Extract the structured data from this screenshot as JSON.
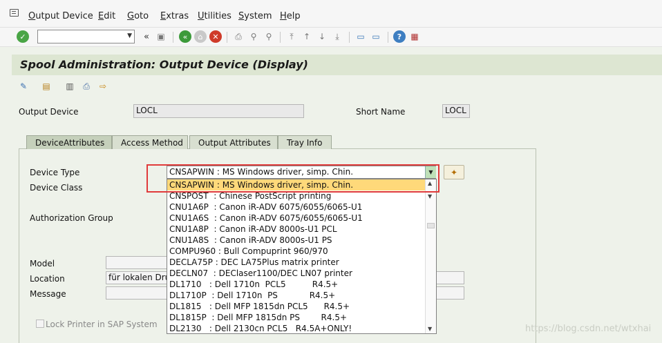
{
  "menu": {
    "items": [
      "Output Device",
      "Edit",
      "Goto",
      "Extras",
      "Utilities",
      "System",
      "Help"
    ]
  },
  "toolbar": {
    "command_value": ""
  },
  "title": "Spool Administration: Output Device (Display)",
  "header": {
    "output_device_label": "Output Device",
    "output_device_value": "LOCL",
    "short_name_label": "Short Name",
    "short_name_value": "LOCL"
  },
  "tabs": [
    {
      "label": "DeviceAttributes",
      "active": true
    },
    {
      "label": "Access Method",
      "active": false
    },
    {
      "label": "Output Attributes",
      "active": false
    },
    {
      "label": "Tray Info",
      "active": false
    }
  ],
  "form": {
    "device_type_label": "Device Type",
    "device_type_value": "CNSAPWIN : MS Windows driver, simp. Chin.",
    "device_class_label": "Device Class",
    "authorization_group_label": "Authorization Group",
    "model_label": "Model",
    "model_value": "",
    "location_label": "Location",
    "location_value": "für lokalen Druck",
    "message_label": "Message",
    "message_value": "",
    "lock_printer_label": "Lock Printer in SAP System"
  },
  "dropdown": {
    "selected_index": 0,
    "items": [
      "CNSAPWIN : MS Windows driver, simp. Chin.",
      "CNSPOST  : Chinese PostScript printing",
      "CNU1A6P  : Canon iR-ADV 6075/6055/6065-U1",
      "CNU1A6S  : Canon iR-ADV 6075/6055/6065-U1",
      "CNU1A8P  : Canon iR-ADV 8000s-U1 PCL",
      "CNU1A8S  : Canon iR-ADV 8000s-U1 PS",
      "COMPU960 : Bull Compuprint 960/970",
      "DECLA75P : DEC LA75Plus matrix printer",
      "DECLN07  : DEClaser1100/DEC LN07 printer",
      "DL1710   : Dell 1710n  PCL5          R4.5+",
      "DL1710P  : Dell 1710n  PS            R4.5+",
      "DL1815   : Dell MFP 1815dn PCL5      R4.5+",
      "DL1815P  : Dell MFP 1815dn PS        R4.5+",
      "DL2130   : Dell 2130cn PCL5   R4.5A+ONLY!"
    ]
  },
  "watermark": "https://blog.csdn.net/wtxhai",
  "colors": {
    "highlight_border": "#e03a3a",
    "selected_row": "#ffd97a",
    "title_band": "#dde6d2",
    "background": "#eef2ea"
  }
}
